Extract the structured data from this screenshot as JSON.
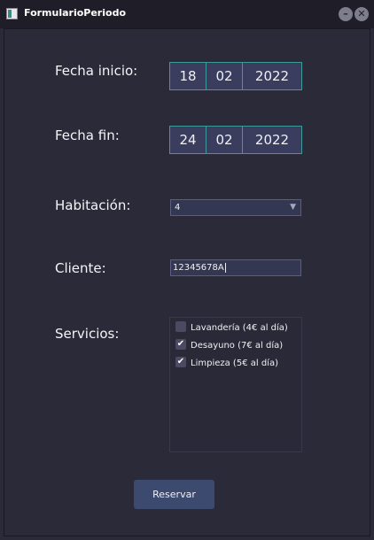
{
  "window": {
    "title": "FormularioPeriodo",
    "min_label": "–",
    "close_label": "✕"
  },
  "form": {
    "fecha_inicio": {
      "label": "Fecha inicio:",
      "day": "18",
      "month": "02",
      "year": "2022"
    },
    "fecha_fin": {
      "label": "Fecha fin:",
      "day": "24",
      "month": "02",
      "year": "2022"
    },
    "habitacion": {
      "label": "Habitación:",
      "value": "4"
    },
    "cliente": {
      "label": "Cliente:",
      "value": "12345678A"
    },
    "servicios": {
      "label": "Servicios:",
      "items": [
        {
          "label": "Lavandería (4€ al día)",
          "checked": false
        },
        {
          "label": "Desayuno (7€ al día)",
          "checked": true
        },
        {
          "label": "Limpieza (5€ al día)",
          "checked": true
        }
      ]
    },
    "submit_label": "Reservar"
  },
  "colors": {
    "background": "#2b2a38",
    "accent_border": "#3f9a9a",
    "button": "#3d4a70"
  }
}
